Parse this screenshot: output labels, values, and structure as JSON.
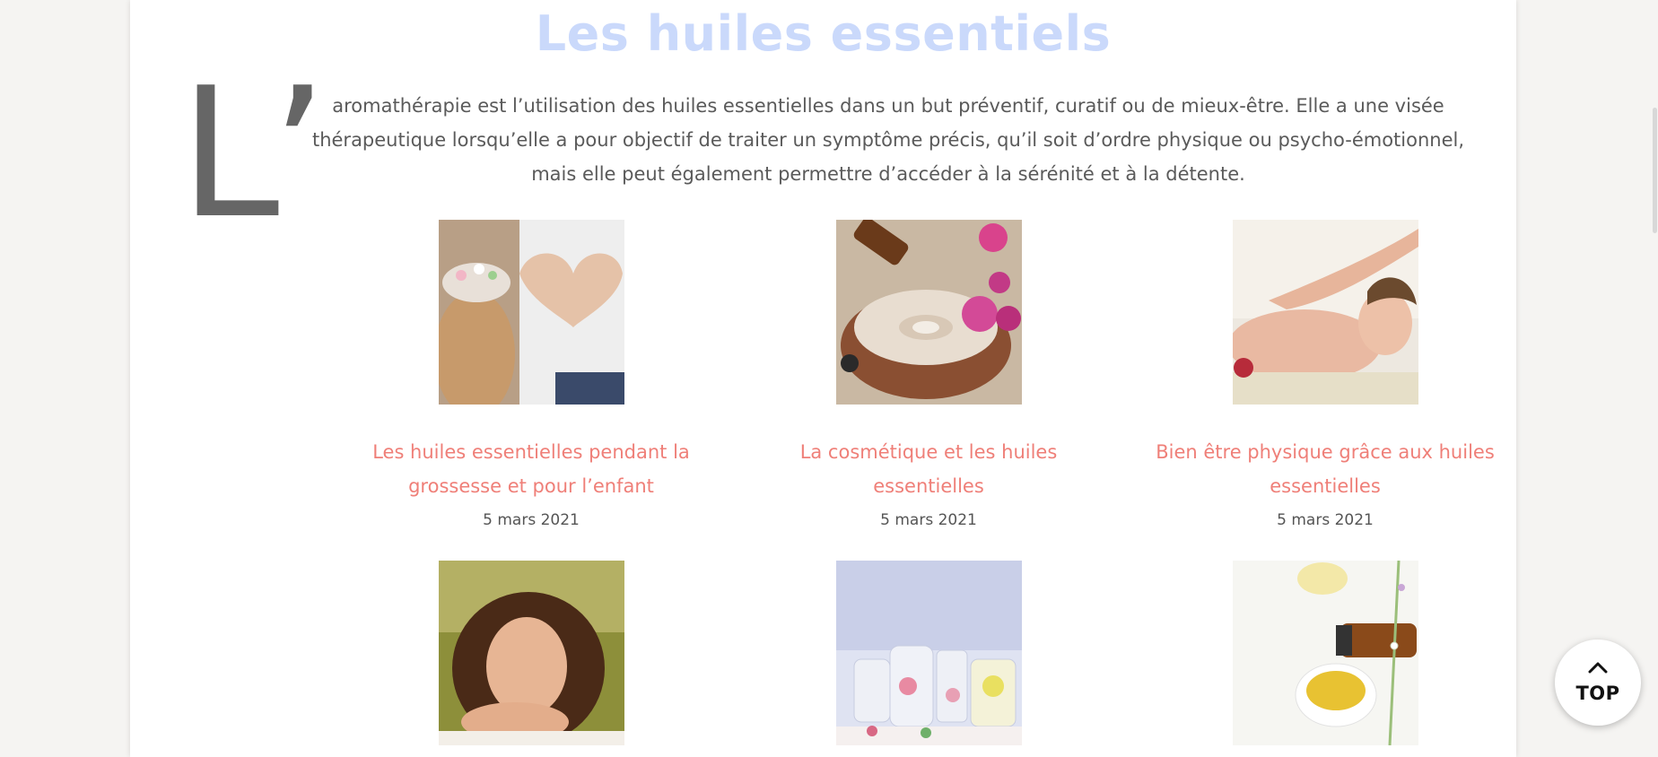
{
  "header": {
    "title": "Les huiles essentiels"
  },
  "intro": {
    "dropcap": "L’",
    "text": "aromathérapie est l’utilisation des huiles essentielles dans un but préventif, curatif ou de mieux-être. Elle a une visée thérapeutique lorsqu’elle a pour objectif de traiter un symptôme précis, qu’il soit d’ordre physique ou psycho-émotionnel, mais elle peut également permettre d’accéder à la sérénité et à la détente."
  },
  "articles": [
    {
      "title": "Les huiles essentielles pendant la grossesse et pour l’enfant",
      "date": "5 mars 2021"
    },
    {
      "title": "La cosmétique et les huiles essentielles",
      "date": "5 mars 2021"
    },
    {
      "title": "Bien être physique grâce aux huiles essentielles",
      "date": "5 mars 2021"
    }
  ],
  "top_button": {
    "label": "TOP",
    "icon": "chevron-up-icon"
  },
  "colors": {
    "title": "#cad9fb",
    "article_link": "#ef7f78",
    "text": "#5a5a5a"
  }
}
